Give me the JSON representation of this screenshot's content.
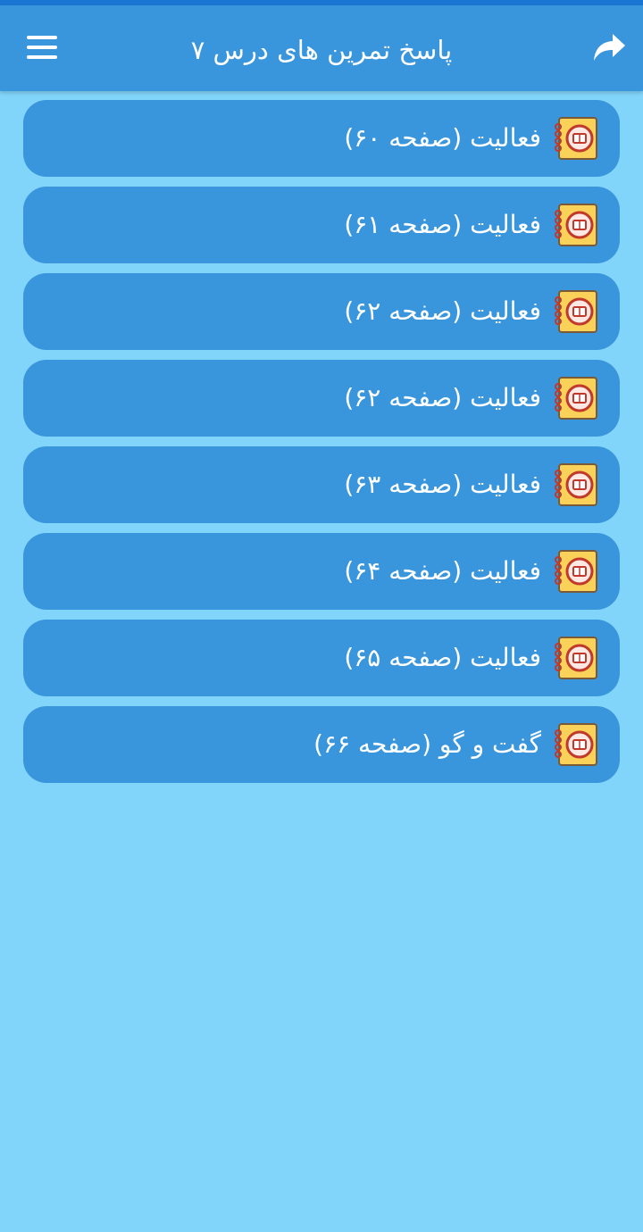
{
  "header": {
    "title": "پاسخ تمرین های درس ۷",
    "menu_icon": "hamburger-menu-icon",
    "share_icon": "share-arrow-icon"
  },
  "colors": {
    "app_bar": "#3a96dc",
    "background": "#81d4fa",
    "list_item": "#3a96dc",
    "text": "#ffffff"
  },
  "list": {
    "item_icon": "notebook-icon",
    "items": [
      {
        "label": "فعالیت (صفحه ۶۰)"
      },
      {
        "label": "فعالیت (صفحه ۶۱)"
      },
      {
        "label": "فعالیت (صفحه ۶۲)"
      },
      {
        "label": "فعالیت (صفحه ۶۲)"
      },
      {
        "label": "فعالیت (صفحه ۶۳)"
      },
      {
        "label": "فعالیت (صفحه ۶۴)"
      },
      {
        "label": "فعالیت (صفحه ۶۵)"
      },
      {
        "label": "گفت و گو (صفحه ۶۶)"
      }
    ]
  }
}
